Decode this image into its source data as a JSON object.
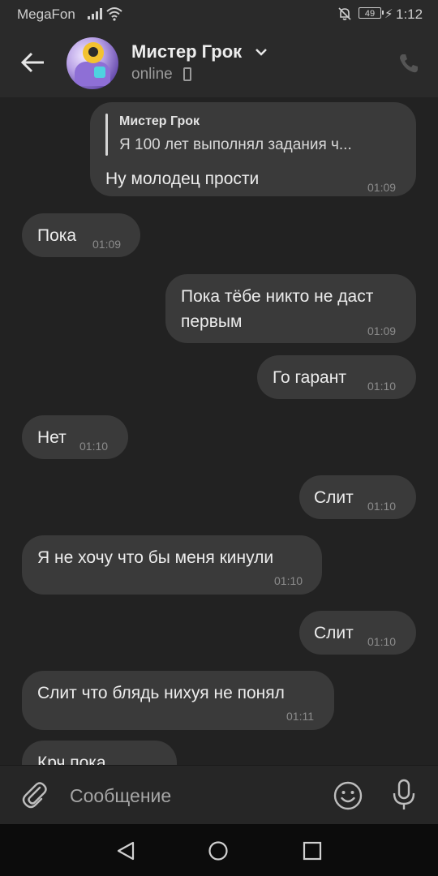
{
  "status_bar": {
    "carrier": "MegaFon",
    "battery": "49",
    "time": "1:12"
  },
  "header": {
    "contact_name": "Мистер Грок",
    "status": "online"
  },
  "messages": [
    {
      "direction": "outgoing",
      "reply": {
        "name": "Мистер Грок",
        "text": "Я 100 лет выполнял задания ч..."
      },
      "lines": [
        "Ну молодец прости"
      ],
      "time": "01:09"
    },
    {
      "direction": "incoming",
      "lines": [
        "Пока"
      ],
      "time": "01:09"
    },
    {
      "direction": "outgoing",
      "lines": [
        "Пока тёбе никто не даст",
        "первым"
      ],
      "time": "01:09"
    },
    {
      "direction": "outgoing",
      "lines": [
        "Го гарант"
      ],
      "time": "01:10"
    },
    {
      "direction": "incoming",
      "lines": [
        "Нет"
      ],
      "time": "01:10"
    },
    {
      "direction": "outgoing",
      "lines": [
        "Слит"
      ],
      "time": "01:10"
    },
    {
      "direction": "incoming",
      "lines": [
        "Я не хочу что бы меня кинули"
      ],
      "time": "01:10"
    },
    {
      "direction": "outgoing",
      "lines": [
        "Слит"
      ],
      "time": "01:10"
    },
    {
      "direction": "incoming",
      "lines": [
        "Слит что блядь нихуя не понял"
      ],
      "time": "01:11"
    },
    {
      "direction": "incoming",
      "lines": [
        "Крч пока"
      ],
      "time": ""
    }
  ],
  "composer": {
    "placeholder": "Сообщение"
  },
  "icons": {
    "back": "arrow-left-icon",
    "call": "phone-icon",
    "attach": "paperclip-icon",
    "emoji": "smiley-icon",
    "voice": "microphone-icon"
  },
  "colors": {
    "background": "#222222",
    "bubble": "#3a3a3a",
    "header": "#2a2a2a",
    "navbar": "#0c0c0c"
  }
}
